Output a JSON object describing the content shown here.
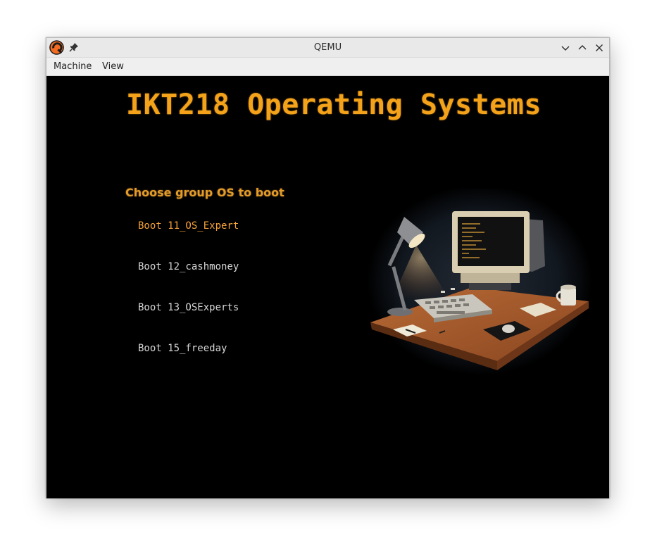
{
  "window": {
    "title": "QEMU",
    "app_icon": "qemu-icon",
    "controls": [
      "minimize-icon",
      "maximize-icon",
      "close-icon"
    ]
  },
  "menubar": {
    "items": [
      {
        "label": "Machine"
      },
      {
        "label": "View"
      }
    ]
  },
  "boot_screen": {
    "banner": "IKT218 Operating Systems",
    "prompt": "Choose group OS to boot",
    "entries": [
      {
        "label": "Boot 11_OS_Expert",
        "selected": true
      },
      {
        "label": "Boot 12_cashmoney",
        "selected": false
      },
      {
        "label": "Boot 13_OSExperts",
        "selected": false
      },
      {
        "label": "Boot 15_freeday",
        "selected": false
      }
    ],
    "illustration": "retro-computer-desk-illustration",
    "colors": {
      "background": "#000000",
      "banner": "#f3a21a",
      "selected": "#f6a23a",
      "normal": "#d7d7d7"
    }
  }
}
